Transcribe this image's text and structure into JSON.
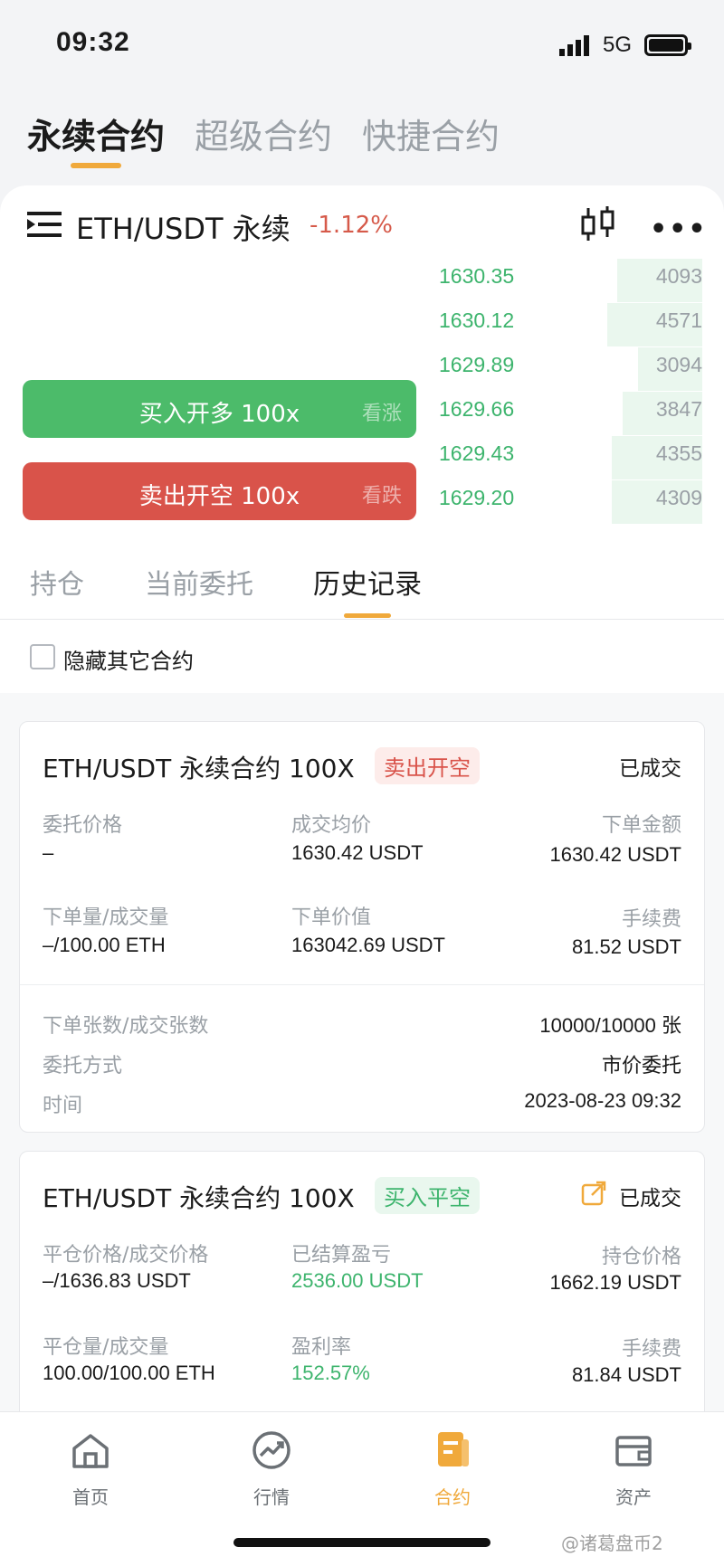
{
  "status_bar": {
    "time": "09:32",
    "network": "5G"
  },
  "top_tabs": [
    {
      "label": "永续合约",
      "active": true
    },
    {
      "label": "超级合约",
      "active": false
    },
    {
      "label": "快捷合约",
      "active": false
    }
  ],
  "pair": {
    "title": "ETH/USDT 永续",
    "change": "-1.12%",
    "change_color": "#d65a4a"
  },
  "order_book": [
    {
      "price": "1630.35",
      "qty": "4093",
      "depth": 0.33
    },
    {
      "price": "1630.12",
      "qty": "4571",
      "depth": 0.37
    },
    {
      "price": "1629.89",
      "qty": "3094",
      "depth": 0.25
    },
    {
      "price": "1629.66",
      "qty": "3847",
      "depth": 0.31
    },
    {
      "price": "1629.43",
      "qty": "4355",
      "depth": 0.35
    },
    {
      "price": "1629.20",
      "qty": "4309",
      "depth": 0.35
    }
  ],
  "buttons": {
    "buy": {
      "label": "买入开多 100x",
      "hint": "看涨",
      "color": "#4cbb6a"
    },
    "sell": {
      "label": "卖出开空 100x",
      "hint": "看跌",
      "color": "#d9534a"
    }
  },
  "order_tabs": [
    {
      "label": "持仓",
      "active": false
    },
    {
      "label": "当前委托",
      "active": false
    },
    {
      "label": "历史记录",
      "active": true
    }
  ],
  "hide_others": {
    "label": "隐藏其它合约",
    "checked": false
  },
  "orders": [
    {
      "title": "ETH/USDT 永续合约 100X",
      "badge": "卖出开空",
      "status": "已成交",
      "fields": [
        {
          "label": "委托价格",
          "value": "–"
        },
        {
          "label": "成交均价",
          "value": "1630.42 USDT"
        },
        {
          "label": "下单金额",
          "value": "1630.42 USDT"
        },
        {
          "label": "下单量/成交量",
          "value": "–/100.00 ETH"
        },
        {
          "label": "下单价值",
          "value": "163042.69 USDT"
        },
        {
          "label": "手续费",
          "value": "81.52 USDT"
        }
      ],
      "details": [
        {
          "label": "下单张数/成交张数",
          "value": "10000/10000 张"
        },
        {
          "label": "委托方式",
          "value": "市价委托"
        },
        {
          "label": "时间",
          "value": "2023-08-23 09:32"
        }
      ]
    },
    {
      "title": "ETH/USDT 永续合约 100X",
      "badge": "买入平空",
      "status": "已成交",
      "fields": [
        {
          "label": "平仓价格/成交价格",
          "value": "–/1636.83 USDT"
        },
        {
          "label": "已结算盈亏",
          "value": "2536.00 USDT"
        },
        {
          "label": "持仓价格",
          "value": "1662.19 USDT"
        },
        {
          "label": "平仓量/成交量",
          "value": "100.00/100.00 ETH"
        },
        {
          "label": "盈利率",
          "value": "152.57%"
        },
        {
          "label": "手续费",
          "value": "81.84 USDT"
        }
      ]
    }
  ],
  "bottom_nav": [
    {
      "label": "首页",
      "icon": "home-icon",
      "active": false
    },
    {
      "label": "行情",
      "icon": "market-icon",
      "active": false
    },
    {
      "label": "合约",
      "icon": "contract-icon",
      "active": true
    },
    {
      "label": "资产",
      "icon": "wallet-icon",
      "active": false
    }
  ],
  "watermark": "@诸葛盘币2",
  "colors": {
    "accent": "#f0a93b",
    "up": "#3db46d",
    "down": "#d9534a"
  }
}
